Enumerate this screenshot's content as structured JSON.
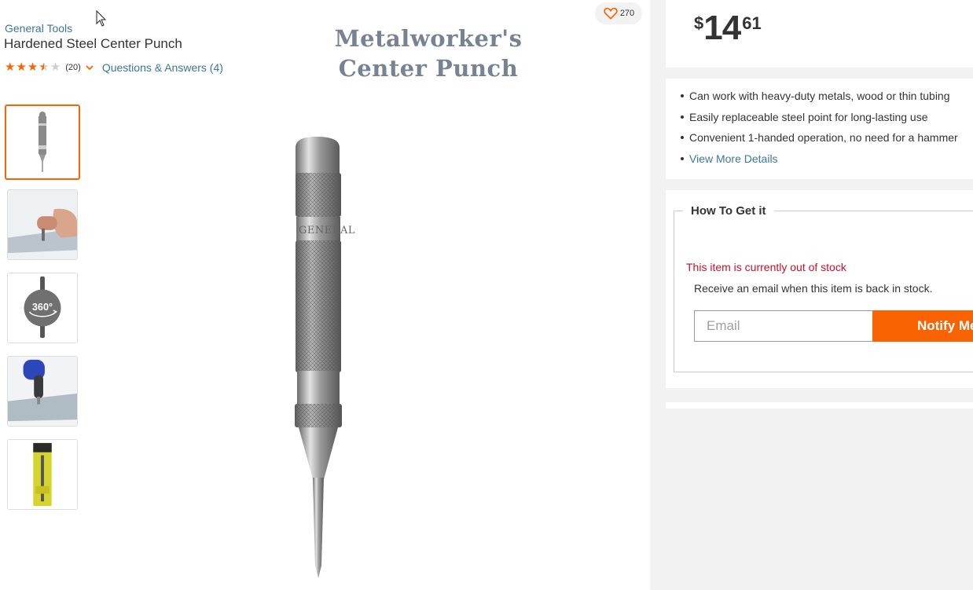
{
  "product": {
    "brand": "General Tools",
    "title": "Hardened Steel Center Punch",
    "rating": {
      "stars": 3.5,
      "max": 5,
      "count_label": "(20)"
    },
    "qa_label": "Questions & Answers (4)",
    "favorites": {
      "count": "270",
      "icon": "heart-icon"
    }
  },
  "media": {
    "overlay_title": [
      "Metalworker's",
      "Center Punch"
    ],
    "thumbnails": [
      {
        "kind": "product-front",
        "active": true
      },
      {
        "kind": "in-use-hand",
        "active": false
      },
      {
        "kind": "view-360",
        "label": "360°",
        "active": false
      },
      {
        "kind": "in-use-drill",
        "active": false
      },
      {
        "kind": "packaging",
        "active": false
      }
    ],
    "main_image_text": "GENERAL"
  },
  "pricing": {
    "currency": "$",
    "dollars": "14",
    "cents": "61"
  },
  "highlights": {
    "bullets": [
      "Can work with heavy-duty metals, wood or thin tubing",
      "Easily replaceable steel point for long-lasting use",
      "Convenient 1-handed operation, no need for a hammer"
    ],
    "more_link": "View More Details"
  },
  "fulfillment": {
    "heading": "How To Get it",
    "status": "This item is currently out of stock",
    "notify_text": "Receive an email when this item is back in stock.",
    "email_placeholder": "Email",
    "notify_button": "Notify Me"
  },
  "colors": {
    "accent": "#f96302",
    "link": "#3e7697",
    "error": "#c8102e",
    "panel": "#f2f2f2"
  }
}
